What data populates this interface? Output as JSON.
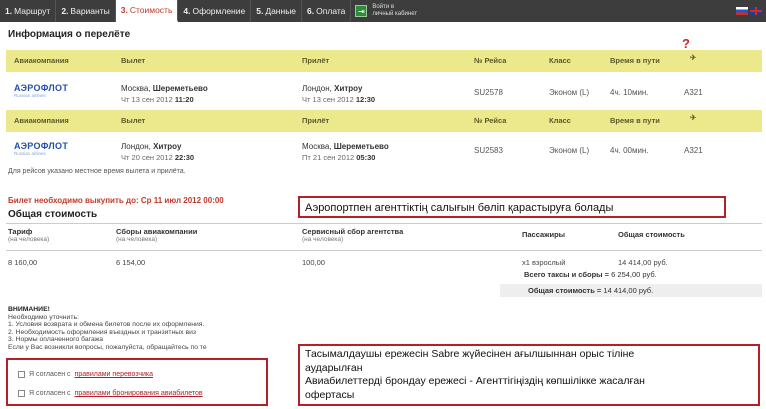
{
  "nav": {
    "tabs": [
      {
        "num": "1.",
        "label": "Маршрут"
      },
      {
        "num": "2.",
        "label": "Варианты"
      },
      {
        "num": "3.",
        "label": "Стоимость"
      },
      {
        "num": "4.",
        "label": "Оформление"
      },
      {
        "num": "5.",
        "label": "Данные"
      },
      {
        "num": "6.",
        "label": "Оплата"
      }
    ],
    "cabinet_line1": "Войти в",
    "cabinet_line2": "личный кабинет"
  },
  "flight_info": {
    "title": "Информация о перелёте",
    "help_mark": "?",
    "headers": {
      "airline": "Авиакомпания",
      "departure": "Вылет",
      "arrival": "Прилёт",
      "flight": "№ Рейса",
      "class": "Класс",
      "duration": "Время в пути"
    },
    "airline_logo": "АЭРОФЛОТ",
    "airline_logo_sub": "Russian airlines",
    "flights": [
      {
        "dep_city": "Москва, ",
        "dep_airport": "Шереметьево",
        "dep_date": "Чт 13 сен 2012 ",
        "dep_time": "11:20",
        "arr_city": "Лондон, ",
        "arr_airport": "Хитроу",
        "arr_date": "Чт 13 сен 2012 ",
        "arr_time": "12:30",
        "flight": "SU2578",
        "class": "Эконом (L)",
        "duration": "4ч. 10мин.",
        "aircraft": "A321"
      },
      {
        "dep_city": "Лондон, ",
        "dep_airport": "Хитроу",
        "dep_date": "Чт 20 сен 2012 ",
        "dep_time": "22:30",
        "arr_city": "Москва, ",
        "arr_airport": "Шереметьево",
        "arr_date": "Пт 21 сен 2012 ",
        "arr_time": "05:30",
        "flight": "SU2583",
        "class": "Эконом (L)",
        "duration": "4ч. 00мин.",
        "aircraft": "A321"
      }
    ],
    "local_time_note": "Для рейсов указано местное время вылета и прилёта."
  },
  "deadline": "Билет необходимо выкупить до: Ср 11 июл 2012 00:00",
  "cost": {
    "title": "Общая стоимость",
    "headers": {
      "tariff": "Тариф",
      "tariff_sub": "(на человека)",
      "fees": "Сборы авиакомпании",
      "fees_sub": "(на человека)",
      "service": "Сервисный сбор агентства",
      "service_sub": "(на человека)",
      "passengers": "Пассажиры",
      "total": "Общая стоимость"
    },
    "row": {
      "tariff": "8 160,00",
      "fees": "6 154,00",
      "service": "100,00",
      "passengers": "x1 взрослый",
      "total": "14 414,00 руб."
    },
    "taxes_label": "Всего таксы и сборы =",
    "taxes_value": "6 254,00 руб.",
    "grand_label": "Общая стоимость =",
    "grand_value": "14 414,00 руб."
  },
  "warning": {
    "title": "ВНИМАНИЕ!",
    "line0": "Необходимо уточнить:",
    "line1": "1. Условия возврата и обмена билетов после их оформления.",
    "line2": "2. Необходимость оформления въездных и транзитных виз",
    "line3": "3. Нормы оплаченного багажа",
    "line4": "Если у Вас возникли вопросы, пожалуйста, обращайтесь по те"
  },
  "agreements": [
    {
      "prefix": "Я согласен с ",
      "link": "правилами перевозчика"
    },
    {
      "prefix": "Я согласен с ",
      "link": "правилами бронирования авиабилетов"
    }
  ],
  "callouts": {
    "airport": "Аэропортпен агенттіктің салығын бөліп қарастыруға болады",
    "rules_1": "Тасымалдаушы ережесін Sabre жүйесінен ағылшыннан орыс тіліне",
    "rules_2": "аударылған",
    "rules_3": "Авиабилеттерді брондау ережесі - Агенттігіңіздің көпшілікке жасалған",
    "rules_4": "офертасы"
  },
  "colors": {
    "header_row": "#ece98c",
    "accent": "#b51f28",
    "nav": "#3d3d3d"
  }
}
